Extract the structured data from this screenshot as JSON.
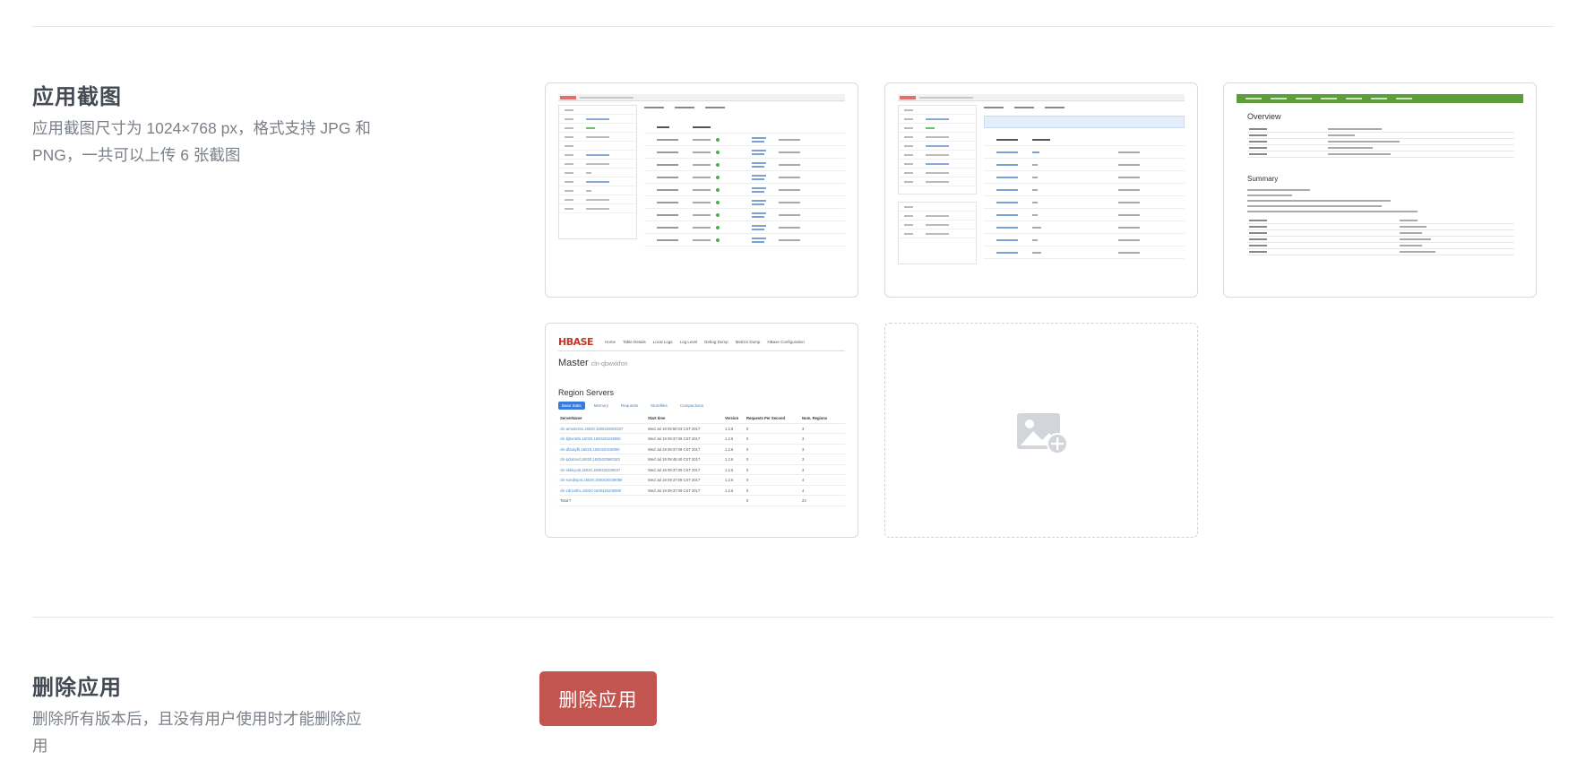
{
  "screenshots_section": {
    "title": "应用截图",
    "description": "应用截图尺寸为 1024×768 px，格式支持 JPG 和 PNG，一共可以上传 6 张截图"
  },
  "thumbnails": [
    {
      "name": "screenshot-1",
      "kind": "cluster-list"
    },
    {
      "name": "screenshot-2",
      "kind": "cluster-config"
    },
    {
      "name": "screenshot-3",
      "kind": "hdfs-overview"
    },
    {
      "name": "screenshot-4",
      "kind": "hbase-master"
    }
  ],
  "hdfs_overview": {
    "heading": "Overview",
    "subheading": "Summary"
  },
  "hbase_shot": {
    "logo": "HBASE",
    "nav": [
      "Home",
      "Table Details",
      "Local Logs",
      "Log Level",
      "Debug Dump",
      "Metrics Dump",
      "HBase Configuration"
    ],
    "master_label": "Master",
    "master_host": "cln-qbwxkfon",
    "region_servers_title": "Region Servers",
    "pills": [
      "Base Stats",
      "Memory",
      "Requests",
      "Storefiles",
      "Compactions"
    ],
    "columns": [
      "ServerName",
      "Start time",
      "Version",
      "Requests Per Second",
      "Num. Regions"
    ],
    "rows": [
      [
        "cln-armxtv3ns,16020,1500420603337",
        "Wed Jul 19 09:50:03 CST 2017",
        "1.2.6",
        "0",
        "3"
      ],
      [
        "cln-bj5xn82k,16020,1500420239050",
        "Wed Jul 19 09:37:09 CST 2017",
        "1.2.6",
        "0",
        "3"
      ],
      [
        "cln-dl2asyfb,16020,1500420239060",
        "Wed Jul 19 09:37:09 CST 2017",
        "1.2.6",
        "0",
        "3"
      ],
      [
        "cln-ip3xbrvd,16020,1500420580183",
        "Wed Jul 19 09:49:40 CST 2017",
        "1.2.6",
        "0",
        "3"
      ],
      [
        "cln-nkkkyui6,16020,1500420239047",
        "Wed Jul 19 09:37:09 CST 2017",
        "1.2.6",
        "0",
        "3"
      ],
      [
        "cln-sxrrdtvp4r,16020,1500420239089",
        "Wed Jul 19 09:37:09 CST 2017",
        "1.2.6",
        "0",
        "4"
      ],
      [
        "cln-zdr1x9hc,16020,1500420239089",
        "Wed Jul 19 09:37:09 CST 2017",
        "1.2.6",
        "0",
        "4"
      ]
    ],
    "total_label": "Total:7",
    "total_rps": "0",
    "total_regions": "23"
  },
  "upload_placeholder": {
    "icon": "image-add-icon"
  },
  "delete_section": {
    "title": "删除应用",
    "description": "删除所有版本后，且没有用户使用时才能删除应用",
    "button_label": "删除应用",
    "button_color": "#c2554f"
  }
}
